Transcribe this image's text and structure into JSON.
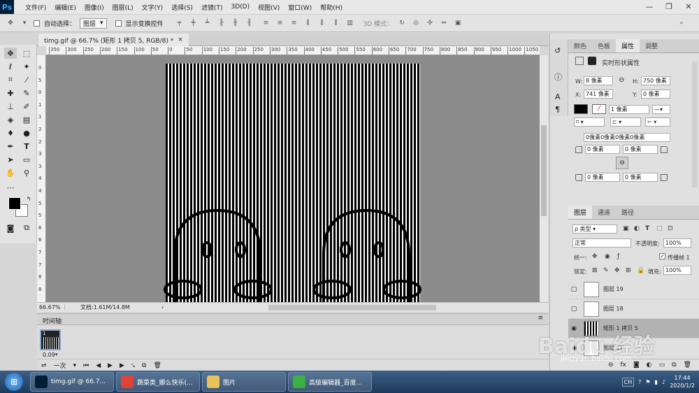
{
  "app": {
    "logo": "Ps"
  },
  "menu": [
    "文件(F)",
    "编辑(E)",
    "图像(I)",
    "图层(L)",
    "文字(Y)",
    "选择(S)",
    "滤镜(T)",
    "3D(D)",
    "视图(V)",
    "窗口(W)",
    "帮助(H)"
  ],
  "options": {
    "auto_select_label": "自动选择：",
    "auto_select_value": "图层",
    "show_transform_label": "显示变换控件",
    "mode_3d_label": "3D 模式："
  },
  "document": {
    "tab_title": "timg.gif @ 66.7% (矩形 1 拷贝 5, RGB/8) *",
    "close_glyph": "×"
  },
  "ruler": {
    "h_labels": [
      "350",
      "300",
      "250",
      "200",
      "150",
      "100",
      "50",
      "0",
      "50",
      "100",
      "150",
      "200",
      "250",
      "300",
      "350",
      "400",
      "450",
      "500",
      "550",
      "600",
      "650",
      "700",
      "750",
      "800",
      "850",
      "900",
      "950",
      "1000",
      "1050"
    ],
    "v_labels": [
      "0",
      "5",
      "0",
      "1",
      "1",
      "2",
      "2",
      "3",
      "3",
      "4",
      "4",
      "5",
      "5",
      "6",
      "6",
      "7",
      "7",
      "8",
      "8"
    ]
  },
  "status": {
    "zoom": "66.67%",
    "doc": "文档:1.61M/14.8M"
  },
  "timeline": {
    "title": "时间轴",
    "frame_num": "1",
    "frame_time": "0.09",
    "loop_value": "一次"
  },
  "properties": {
    "tabs": [
      "颜色",
      "色板",
      "属性",
      "调整"
    ],
    "active_tab": "属性",
    "heading": "实时形状属性",
    "w_label": "W:",
    "w_value": "8 像素",
    "h_label": "H:",
    "h_value": "750 像素",
    "x_label": "X:",
    "x_value": "741 像素",
    "y_label": "Y:",
    "y_value": "0 像素",
    "stroke_width": "1 像素",
    "corner_all": "0像素0像素0像素0像素",
    "corner_tl": "0 像素",
    "corner_tr": "0 像素",
    "corner_bl": "0 像素",
    "corner_br": "0 像素"
  },
  "layers": {
    "tabs": [
      "图层",
      "通道",
      "路径"
    ],
    "filter_type": "ρ 类型",
    "blend_mode": "正常",
    "opacity_label": "不透明度:",
    "opacity_value": "100%",
    "unify_label": "统一:",
    "propagate_label": "传播帧 1",
    "lock_label": "锁定:",
    "fill_label": "填充:",
    "fill_value": "100%",
    "items": [
      {
        "name": "图层 19",
        "visible": false,
        "selected": false
      },
      {
        "name": "图层 18",
        "visible": false,
        "selected": false
      },
      {
        "name": "矩形 1 拷贝 5",
        "visible": true,
        "selected": true
      },
      {
        "name": "图层 17",
        "visible": true,
        "selected": false
      }
    ]
  },
  "taskbar": {
    "items": [
      {
        "label": "timg.gif @ 66.7...",
        "icon": "photoshop-icon",
        "color": "#001e36"
      },
      {
        "label": "蔬菜类_娜么快乐(...",
        "icon": "chrome-icon",
        "color": "#db4437"
      },
      {
        "label": "图片",
        "icon": "folder-icon",
        "color": "#e8c15a"
      },
      {
        "label": "高级编辑器_百度...",
        "icon": "browser-icon",
        "color": "#3cb043"
      }
    ],
    "lang": "CH",
    "time": "17:44",
    "date": "2020/1/2"
  },
  "watermark": {
    "text": "Baidu 经验",
    "sub": "jingyan.baidu.com"
  },
  "colors": {
    "ps_blue": "#31a8ff",
    "canvas_gray": "#8c8c8c",
    "selected_layer": "#b3b3b3"
  }
}
